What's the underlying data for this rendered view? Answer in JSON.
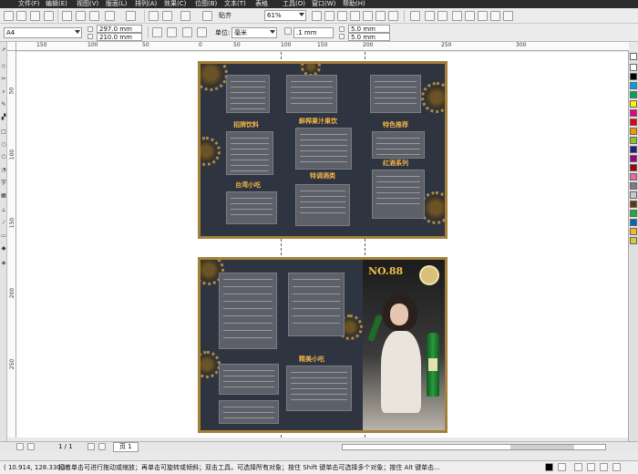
{
  "menubar": {
    "items": [
      "文件(F)",
      "编辑(E)",
      "视图(V)",
      "版面(L)",
      "排列(A)",
      "效果(C)",
      "位图(B)",
      "文本(T)",
      "表格",
      "工具(O)",
      "窗口(W)",
      "帮助(H)"
    ]
  },
  "toolbar1": {
    "paste_label": "贴齐",
    "zoom_value": "61%"
  },
  "toolbar2": {
    "paper_size": "A4",
    "width": "297.0 mm",
    "height": "210.0 mm",
    "unit_label": "单位:",
    "unit_value": "毫米",
    "nudge": ".1 mm",
    "dup_x": "5.0 mm",
    "dup_y": "5.0 mm"
  },
  "ruler": {
    "h_ticks": [
      "150",
      "100",
      "50",
      "0",
      "50",
      "100",
      "150",
      "200",
      "250",
      "300"
    ],
    "v_ticks": [
      "50",
      "100",
      "150",
      "200",
      "250"
    ]
  },
  "menu_pages": {
    "section_titles": [
      "招牌饮料",
      "鲜榨果汁果饮",
      "特色推荐",
      "特调酒类",
      "红酒系列",
      "台湾小吃",
      "精美小吃"
    ],
    "brand": "NO.88"
  },
  "pagebar": {
    "page_counter": "1 / 1",
    "page_tab": "页 1"
  },
  "statusbar": {
    "coords": "( 10.914, 128.330 )",
    "hint": "接着单击可进行拖动或缩放；再单击可旋转或倾斜；双击工具，可选择所有对象；按住 Shift 键单击可选择多个对象；按住 Alt 键单击..."
  },
  "palette_colors": [
    "#ffffff",
    "#000000",
    "#00a0e9",
    "#00a651",
    "#fff100",
    "#e4007f",
    "#e60012",
    "#f39800",
    "#8fc31f",
    "#1d2088",
    "#920783",
    "#a40000",
    "#ea68a2",
    "#7d7d7d",
    "#c9c9c9",
    "#603813",
    "#22ac38",
    "#0068b7",
    "#f7b52c",
    "#d7c447"
  ]
}
